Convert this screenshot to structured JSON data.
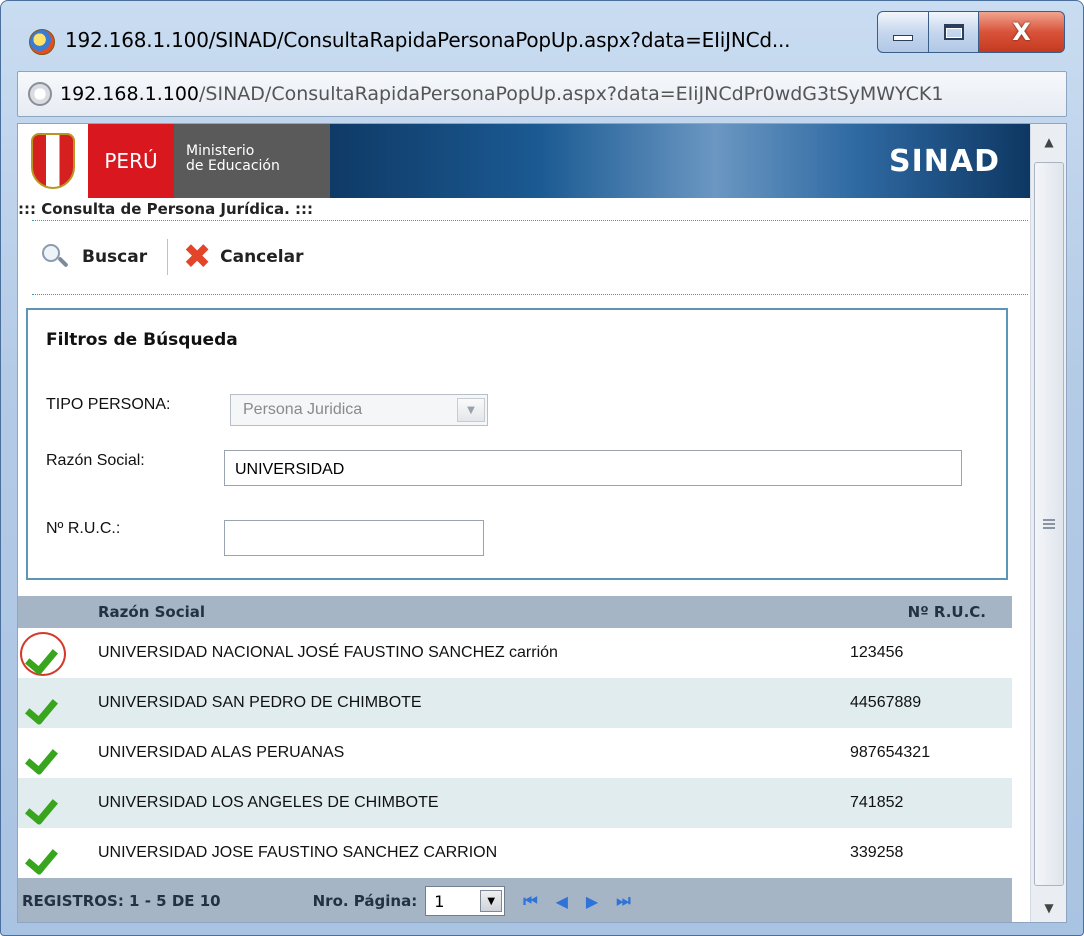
{
  "window": {
    "title": "192.168.1.100/SINAD/ConsultaRapidaPersonaPopUp.aspx?data=EIiJNCd...",
    "close_glyph": "X"
  },
  "address": {
    "host": "192.168.1.100",
    "path": "/SINAD/ConsultaRapidaPersonaPopUp.aspx?data=EIiJNCdPr0wdG3tSyMWYCK1"
  },
  "header": {
    "peru": "PERÚ",
    "ministerio_line1": "Ministerio",
    "ministerio_line2": "de Educación",
    "app": "SINAD"
  },
  "section_title": "::: Consulta de Persona Jurídica. :::",
  "toolbar": {
    "search_label": "Buscar",
    "cancel_label": "Cancelar"
  },
  "filters": {
    "title": "Filtros de Búsqueda",
    "tipo_label": "TIPO PERSONA:",
    "tipo_value": "Persona Juridica",
    "razon_label": "Razón Social:",
    "razon_value": "UNIVERSIDAD",
    "ruc_label": "Nº R.U.C.:",
    "ruc_value": ""
  },
  "grid": {
    "col_razon": "Razón Social",
    "col_ruc": "Nº R.U.C.",
    "rows": [
      {
        "name": "UNIVERSIDAD NACIONAL JOSÉ FAUSTINO SANCHEZ carrión",
        "ruc": "123456"
      },
      {
        "name": "UNIVERSIDAD SAN PEDRO DE CHIMBOTE",
        "ruc": "44567889"
      },
      {
        "name": "UNIVERSIDAD ALAS PERUANAS",
        "ruc": "987654321"
      },
      {
        "name": "UNIVERSIDAD LOS ANGELES DE CHIMBOTE",
        "ruc": "741852"
      },
      {
        "name": "UNIVERSIDAD JOSE FAUSTINO SANCHEZ CARRION",
        "ruc": "339258"
      }
    ]
  },
  "pager": {
    "info": "REGISTROS: 1 - 5 DE 10",
    "page_label": "Nro. Página:",
    "page_value": "1"
  },
  "colors": {
    "accent_red": "#d8171f",
    "grid_header": "#a5b5c6",
    "row_alt": "#e1ecef",
    "check_green": "#39a51e"
  }
}
